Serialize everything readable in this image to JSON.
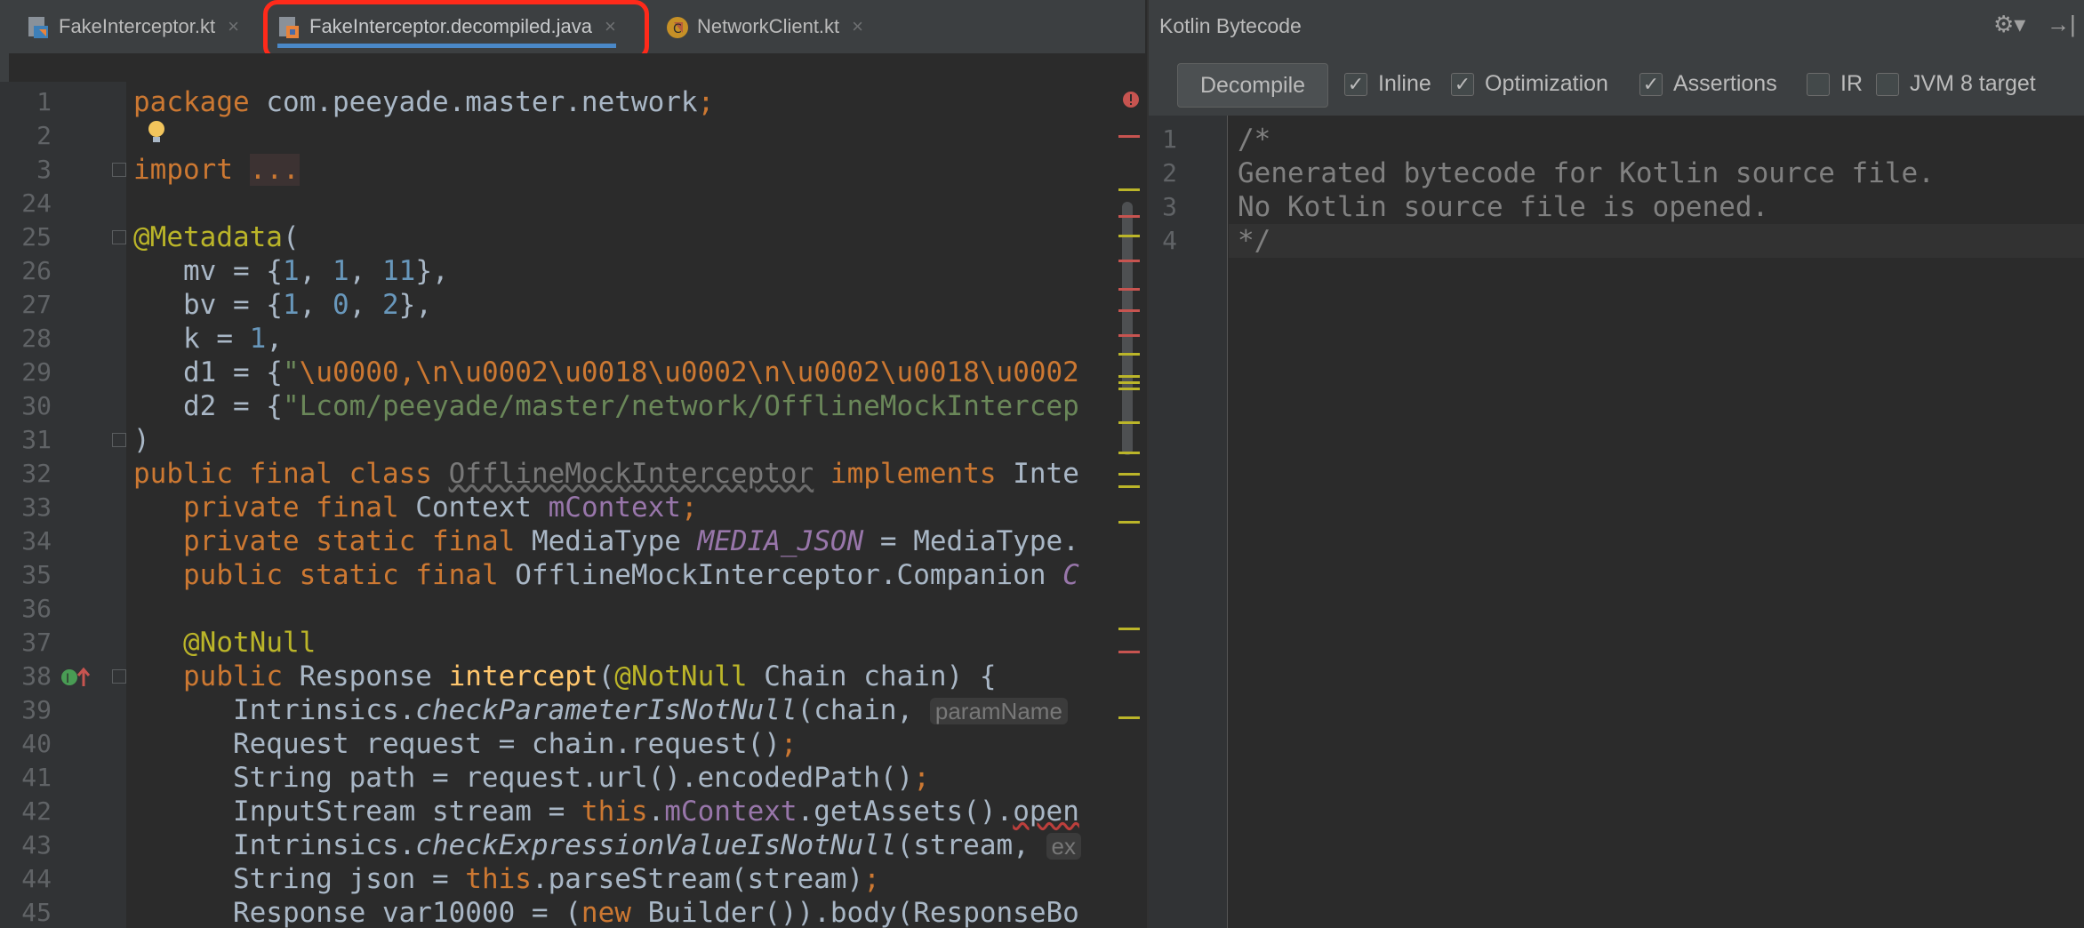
{
  "tabs": [
    {
      "label": "FakeInterceptor.kt",
      "icon": "kotlin-file-icon"
    },
    {
      "label": "FakeInterceptor.decompiled.java",
      "icon": "java-file-icon"
    },
    {
      "label": "NetworkClient.kt",
      "icon": "kotlin-class-icon"
    }
  ],
  "editor": {
    "line_numbers": [
      "1",
      "2",
      "3",
      "24",
      "25",
      "26",
      "27",
      "28",
      "29",
      "30",
      "31",
      "32",
      "33",
      "34",
      "35",
      "36",
      "37",
      "38",
      "39",
      "40",
      "41",
      "42",
      "43",
      "44",
      "45"
    ],
    "hint_paramname": "paramName",
    "hint_ex": "ex"
  },
  "panel": {
    "title": "Kotlin Bytecode",
    "decompile_label": "Decompile",
    "options": [
      {
        "label": "Inline",
        "checked": true
      },
      {
        "label": "Optimization",
        "checked": true
      },
      {
        "label": "Assertions",
        "checked": true
      },
      {
        "label": "IR",
        "checked": false
      },
      {
        "label": "JVM 8 target",
        "checked": false
      }
    ],
    "line_numbers": [
      "1",
      "2",
      "3",
      "4"
    ],
    "lines": [
      "/*",
      "Generated bytecode for Kotlin source file.",
      "No Kotlin source file is opened.",
      "*/"
    ]
  }
}
